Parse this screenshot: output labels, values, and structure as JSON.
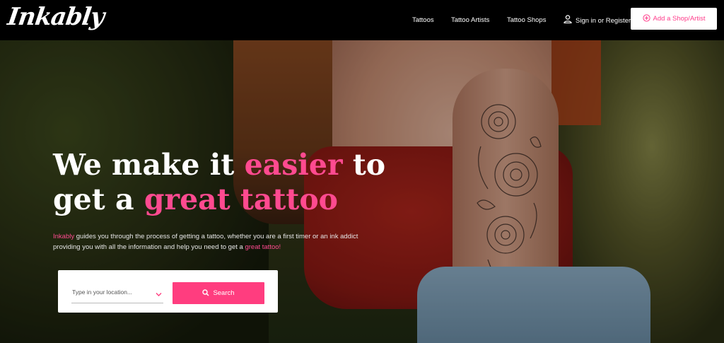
{
  "header": {
    "logo": "Inkably",
    "nav": [
      {
        "label": "Tattoos"
      },
      {
        "label": "Tattoo Artists"
      },
      {
        "label": "Tattoo Shops"
      }
    ],
    "signin_label": "Sign in or Register",
    "add_button_label": "Add a Shop/Artist"
  },
  "hero": {
    "headline": {
      "part1": "We make it ",
      "accent1": "easier",
      "part2": " to",
      "part3": "get a ",
      "accent2": "great tattoo"
    },
    "subtext": {
      "brand": "Inkably",
      "line1": " guides you through the process of getting a tattoo, whether you are a first timer or an ink addict",
      "line2": "providing you with all the information and help  you need to get a ",
      "accent": "great tattoo!"
    },
    "search": {
      "location_placeholder": "Type in your location...",
      "button_label": "Search"
    }
  },
  "colors": {
    "accent": "#ff4a90",
    "header_bg": "#000000",
    "button": "#ff3d7f"
  },
  "icons": [
    "user-icon",
    "plus-circle-icon",
    "chevron-down-icon",
    "search-icon"
  ]
}
